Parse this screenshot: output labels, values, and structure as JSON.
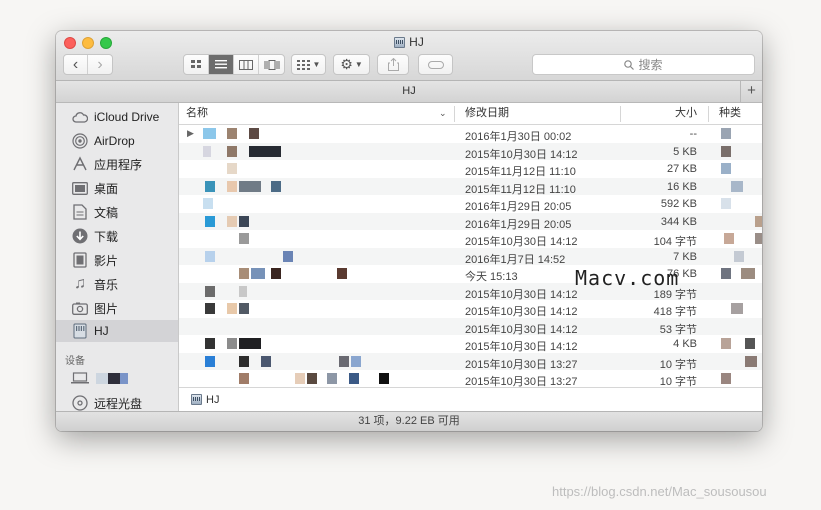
{
  "window": {
    "title": "HJ"
  },
  "toolbar": {
    "view_icons": [
      "icon-view-icon",
      "list-view-icon",
      "column-view-icon",
      "coverflow-view-icon"
    ],
    "back_glyph": "‹",
    "forward_glyph": "›",
    "search_placeholder": "搜索"
  },
  "pathbar": {
    "title": "HJ",
    "plus_label": "+"
  },
  "sidebar": {
    "items": [
      {
        "label": "iCloud Drive",
        "icon": "cloud-icon"
      },
      {
        "label": "AirDrop",
        "icon": "airdrop-icon"
      },
      {
        "label": "应用程序",
        "icon": "applications-icon"
      },
      {
        "label": "桌面",
        "icon": "desktop-icon"
      },
      {
        "label": "文稿",
        "icon": "documents-icon"
      },
      {
        "label": "下载",
        "icon": "download-icon"
      },
      {
        "label": "影片",
        "icon": "movies-icon"
      },
      {
        "label": "音乐",
        "icon": "music-icon"
      },
      {
        "label": "图片",
        "icon": "pictures-icon"
      },
      {
        "label": "HJ",
        "icon": "disk-icon",
        "selected": true
      }
    ],
    "devices_header": "设备",
    "devices": [
      {
        "label": "",
        "icon": "laptop-icon"
      },
      {
        "label": "远程光盘",
        "icon": "optical-disc-icon"
      }
    ]
  },
  "columns": {
    "name": "名称",
    "date": "修改日期",
    "size": "大小",
    "kind": "种类"
  },
  "files": [
    {
      "date": "2016年1月30日 00:02",
      "size": "--",
      "folder": true
    },
    {
      "date": "2015年10月30日 14:12",
      "size": "5 KB"
    },
    {
      "date": "2015年11月12日 11:10",
      "size": "27 KB"
    },
    {
      "date": "2015年11月12日 11:10",
      "size": "16 KB"
    },
    {
      "date": "2016年1月29日 20:05",
      "size": "592 KB"
    },
    {
      "date": "2016年1月29日 20:05",
      "size": "344 KB"
    },
    {
      "date": "2015年10月30日 14:12",
      "size": "104 字节"
    },
    {
      "date": "2016年1月7日 14:52",
      "size": "7 KB"
    },
    {
      "date": "今天 15:13",
      "size": "76 KB"
    },
    {
      "date": "2015年10月30日 14:12",
      "size": "189 字节"
    },
    {
      "date": "2015年10月30日 14:12",
      "size": "418 字节"
    },
    {
      "date": "2015年10月30日 14:12",
      "size": "53 字节"
    },
    {
      "date": "2015年10月30日 14:12",
      "size": "4 KB"
    },
    {
      "date": "2015年10月30日 13:27",
      "size": "10 字节"
    },
    {
      "date": "2015年10月30日 13:27",
      "size": "10 字节"
    }
  ],
  "bottom_path": {
    "label": "HJ"
  },
  "status": {
    "text": "31 项，9.22 EB 可用"
  },
  "watermarks": {
    "macv": "Macv.com",
    "csdn": "https://blog.csdn.net/Mac_sousousou"
  },
  "colors": {
    "close": "#fc605c",
    "minimize": "#fdbc40",
    "maximize": "#34c84a",
    "selected_row": "#d3d3d6"
  }
}
